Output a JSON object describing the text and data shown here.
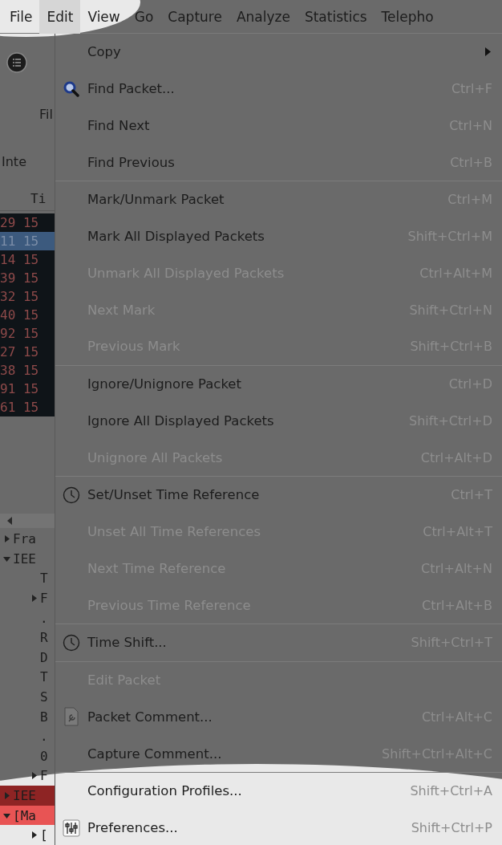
{
  "menubar": [
    {
      "label": "File",
      "selected": false
    },
    {
      "label": "Edit",
      "selected": true
    },
    {
      "label": "View",
      "selected": false
    },
    {
      "label": "Go",
      "selected": false
    },
    {
      "label": "Capture",
      "selected": false
    },
    {
      "label": "Analyze",
      "selected": false
    },
    {
      "label": "Statistics",
      "selected": false
    },
    {
      "label": "Telepho",
      "selected": false
    }
  ],
  "toolbar": {
    "filter_label": "Fil",
    "interface_label": "Inte"
  },
  "packet_list": {
    "header": "Ti",
    "rows": [
      {
        "number": "29",
        "time": "15",
        "selected": false
      },
      {
        "number": "11",
        "time": "15",
        "selected": true
      },
      {
        "number": "14",
        "time": "15",
        "selected": false
      },
      {
        "number": "39",
        "time": "15",
        "selected": false
      },
      {
        "number": "32",
        "time": "15",
        "selected": false
      },
      {
        "number": "40",
        "time": "15",
        "selected": false
      },
      {
        "number": "92",
        "time": "15",
        "selected": false
      },
      {
        "number": "27",
        "time": "15",
        "selected": false
      },
      {
        "number": "38",
        "time": "15",
        "selected": false
      },
      {
        "number": "91",
        "time": "15",
        "selected": false
      },
      {
        "number": "61",
        "time": "15",
        "selected": false
      }
    ]
  },
  "details_tree": [
    {
      "label": "Fra",
      "expanded": false
    },
    {
      "label": "IEE",
      "expanded": true,
      "children": [
        {
          "label": "T"
        },
        {
          "label": "F",
          "expanded": false
        },
        {
          "label": "."
        },
        {
          "label": "R"
        },
        {
          "label": "D"
        },
        {
          "label": "T"
        },
        {
          "label": "S"
        },
        {
          "label": "B"
        },
        {
          "label": "."
        },
        {
          "label": "0"
        },
        {
          "label": "F",
          "expanded": false
        }
      ]
    },
    {
      "label": "IEE",
      "expanded": false,
      "color": "#8e2424"
    },
    {
      "label": "[Ma",
      "expanded": true,
      "color": "#e85454",
      "children": [
        {
          "label": "[",
          "expanded": false
        }
      ]
    }
  ],
  "edit_menu": [
    {
      "kind": "submenu",
      "label": "Copy",
      "disabled": false
    },
    {
      "kind": "search",
      "label": "Find Packet...",
      "shortcut": "Ctrl+F",
      "disabled": false
    },
    {
      "kind": "plain",
      "label": "Find Next",
      "shortcut": "Ctrl+N",
      "disabled": false
    },
    {
      "kind": "plain",
      "label": "Find Previous",
      "shortcut": "Ctrl+B",
      "disabled": false
    },
    {
      "kind": "separator"
    },
    {
      "kind": "plain",
      "label": "Mark/Unmark Packet",
      "shortcut": "Ctrl+M",
      "disabled": false
    },
    {
      "kind": "plain",
      "label": "Mark All Displayed Packets",
      "shortcut": "Shift+Ctrl+M",
      "disabled": false
    },
    {
      "kind": "plain",
      "label": "Unmark All Displayed Packets",
      "shortcut": "Ctrl+Alt+M",
      "disabled": true
    },
    {
      "kind": "plain",
      "label": "Next Mark",
      "shortcut": "Shift+Ctrl+N",
      "disabled": true
    },
    {
      "kind": "plain",
      "label": "Previous Mark",
      "shortcut": "Shift+Ctrl+B",
      "disabled": true
    },
    {
      "kind": "separator"
    },
    {
      "kind": "plain",
      "label": "Ignore/Unignore Packet",
      "shortcut": "Ctrl+D",
      "disabled": false
    },
    {
      "kind": "plain",
      "label": "Ignore All Displayed Packets",
      "shortcut": "Shift+Ctrl+D",
      "disabled": false
    },
    {
      "kind": "plain",
      "label": "Unignore All Packets",
      "shortcut": "Ctrl+Alt+D",
      "disabled": true
    },
    {
      "kind": "separator"
    },
    {
      "kind": "clock",
      "label": "Set/Unset Time Reference",
      "shortcut": "Ctrl+T",
      "disabled": false
    },
    {
      "kind": "plain",
      "label": "Unset All Time References",
      "shortcut": "Ctrl+Alt+T",
      "disabled": true
    },
    {
      "kind": "plain",
      "label": "Next Time Reference",
      "shortcut": "Ctrl+Alt+N",
      "disabled": true
    },
    {
      "kind": "plain",
      "label": "Previous Time Reference",
      "shortcut": "Ctrl+Alt+B",
      "disabled": true
    },
    {
      "kind": "separator"
    },
    {
      "kind": "clock",
      "label": "Time Shift...",
      "shortcut": "Shift+Ctrl+T",
      "disabled": false
    },
    {
      "kind": "separator"
    },
    {
      "kind": "plain",
      "label": "Edit Packet",
      "disabled": true
    },
    {
      "kind": "comment",
      "label": "Packet Comment...",
      "shortcut": "Ctrl+Alt+C",
      "disabled": false
    },
    {
      "kind": "plain",
      "label": "Capture Comment...",
      "shortcut": "Shift+Ctrl+Alt+C",
      "disabled": false
    },
    {
      "kind": "separator"
    },
    {
      "kind": "plain",
      "label": "Configuration Profiles...",
      "shortcut": "Shift+Ctrl+A",
      "disabled": false
    },
    {
      "kind": "preferences",
      "label": "Preferences...",
      "shortcut": "Shift+Ctrl+P",
      "disabled": false
    }
  ]
}
